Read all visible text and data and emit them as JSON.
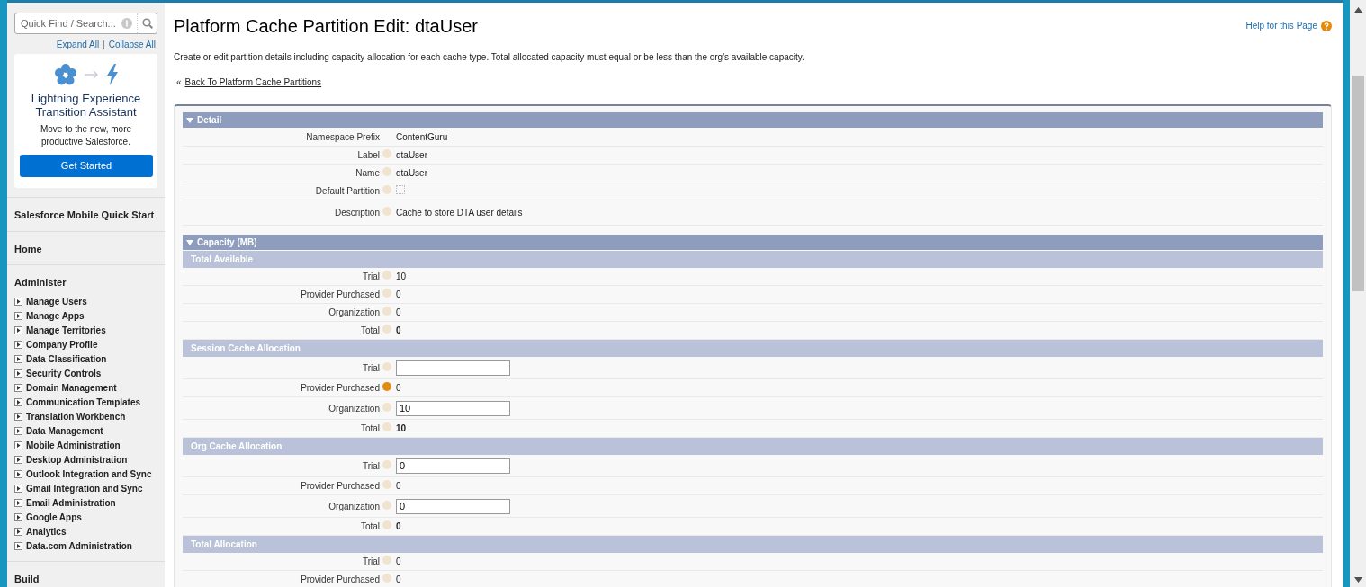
{
  "sidebar": {
    "search": {
      "placeholder": "Quick Find / Search..."
    },
    "expand_all": "Expand All",
    "separator": "|",
    "collapse_all": "Collapse All",
    "promo": {
      "title": "Lightning Experience Transition Assistant",
      "text": "Move to the new, more productive Salesforce.",
      "button": "Get Started"
    },
    "sections": [
      {
        "label": "Salesforce Mobile Quick Start"
      },
      {
        "label": "Home"
      },
      {
        "label": "Administer",
        "items": [
          "Manage Users",
          "Manage Apps",
          "Manage Territories",
          "Company Profile",
          "Data Classification",
          "Security Controls",
          "Domain Management",
          "Communication Templates",
          "Translation Workbench",
          "Data Management",
          "Mobile Administration",
          "Desktop Administration",
          "Outlook Integration and Sync",
          "Gmail Integration and Sync",
          "Email Administration",
          "Google Apps",
          "Analytics",
          "Data.com Administration"
        ]
      },
      {
        "label": "Build"
      }
    ]
  },
  "page": {
    "title": "Platform Cache Partition Edit: dtaUser",
    "help_link": "Help for this Page",
    "description": "Create or edit partition details including capacity allocation for each cache type. Total allocated capacity must equal or be less than the org's available capacity.",
    "back_prefix": "«",
    "back_link": "Back To Platform Cache Partitions"
  },
  "detail": {
    "title": "Detail",
    "rows": [
      {
        "label": "Namespace Prefix",
        "help": false,
        "kind": "text",
        "value": "ContentGuru"
      },
      {
        "label": "Label",
        "help": true,
        "kind": "text",
        "value": "dtaUser"
      },
      {
        "label": "Name",
        "help": true,
        "kind": "text",
        "value": "dtaUser"
      },
      {
        "label": "Default Partition",
        "help": true,
        "kind": "checkbox",
        "checked": false
      },
      {
        "label": "Description",
        "help": true,
        "kind": "text",
        "value": "Cache to store DTA user details"
      }
    ]
  },
  "capacity": {
    "title": "Capacity (MB)",
    "subsections": [
      {
        "title": "Total Available",
        "rows": [
          {
            "label": "Trial",
            "kind": "text",
            "value": "10"
          },
          {
            "label": "Provider Purchased",
            "kind": "text",
            "value": "0"
          },
          {
            "label": "Organization",
            "kind": "text",
            "value": "0"
          },
          {
            "label": "Total",
            "kind": "total",
            "value": "0"
          }
        ]
      },
      {
        "title": "Session Cache Allocation",
        "rows": [
          {
            "label": "Trial",
            "kind": "input",
            "value": ""
          },
          {
            "label": "Provider Purchased",
            "kind": "text",
            "value": "0",
            "help_active": true
          },
          {
            "label": "Organization",
            "kind": "input",
            "value": "10"
          },
          {
            "label": "Total",
            "kind": "total",
            "value": "10"
          }
        ]
      },
      {
        "title": "Org Cache Allocation",
        "rows": [
          {
            "label": "Trial",
            "kind": "input",
            "value": "0"
          },
          {
            "label": "Provider Purchased",
            "kind": "text",
            "value": "0"
          },
          {
            "label": "Organization",
            "kind": "input",
            "value": "0"
          },
          {
            "label": "Total",
            "kind": "total",
            "value": "0"
          }
        ]
      },
      {
        "title": "Total Allocation",
        "rows": [
          {
            "label": "Trial",
            "kind": "text",
            "value": "0"
          },
          {
            "label": "Provider Purchased",
            "kind": "text",
            "value": "0"
          }
        ]
      }
    ]
  }
}
